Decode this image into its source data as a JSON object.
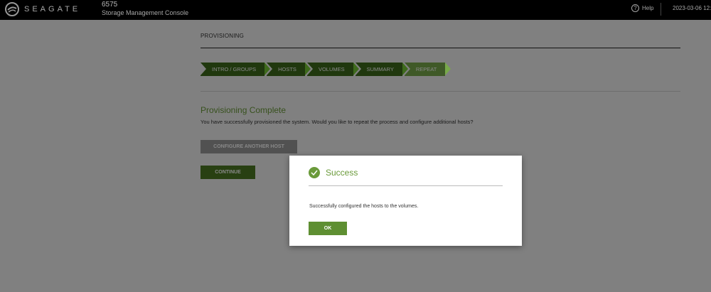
{
  "header": {
    "logo_text": "SEAGATE",
    "system_name": "6575",
    "system_subtitle": "Storage Management Console",
    "help_label": "Help",
    "datetime": "2023-03-06 12:"
  },
  "page": {
    "title": "PROVISIONING",
    "steps": [
      {
        "label": "INTRO / GROUPS",
        "active": false
      },
      {
        "label": "HOSTS",
        "active": false
      },
      {
        "label": "VOLUMES",
        "active": false
      },
      {
        "label": "SUMMARY",
        "active": false
      },
      {
        "label": "REPEAT",
        "active": true
      }
    ],
    "complete_title": "Provisioning Complete",
    "complete_text": "You have successfully provisioned the system. Would you like to repeat the process and configure additional hosts?",
    "configure_button": "CONFIGURE ANOTHER HOST",
    "continue_button": "CONTINUE"
  },
  "modal": {
    "title": "Success",
    "message": "Successfully configured the hosts to the volumes.",
    "ok_button": "OK"
  },
  "colors": {
    "accent_green": "#6a9a3a",
    "step_dark": "#3e6a1c",
    "step_active": "#78a94a"
  }
}
